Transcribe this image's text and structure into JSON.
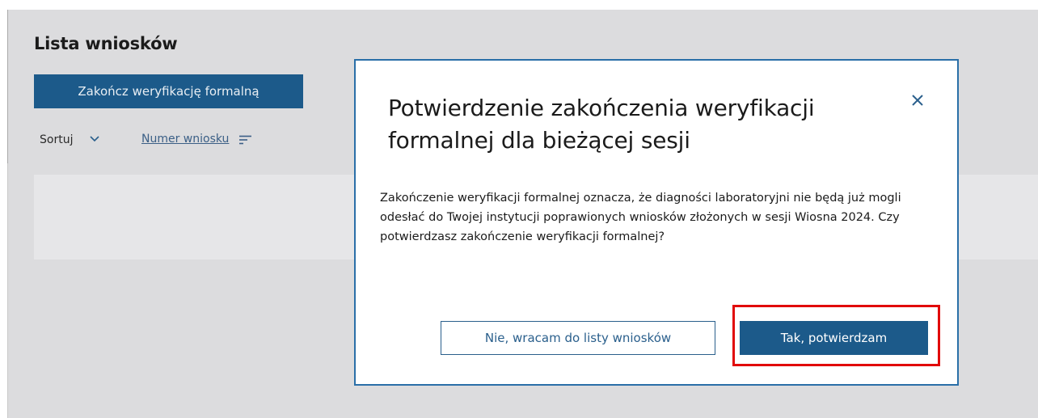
{
  "list": {
    "title": "Lista wniosków",
    "finish_button": "Zakończ weryfikację formalną",
    "sort_label": "Sortuj",
    "sort_field": "Numer wniosku"
  },
  "modal": {
    "title": "Potwierdzenie zakończenia weryfikacji formalnej dla bieżącej sesji",
    "body": "Zakończenie weryfikacji formalnej oznacza, że diagności laboratoryjni nie będą już mogli odesłać do Twojej instytucji poprawionych wniosków złożonych w sesji Wiosna 2024. Czy potwierdzasz zakończenie weryfikacji formalnej?",
    "cancel_button": "Nie, wracam do listy wniosków",
    "confirm_button": "Tak, potwierdzam"
  },
  "icons": {
    "close": "close-icon",
    "sort_dropdown": "chevron-down-icon",
    "sort_order": "sort-lines-icon"
  },
  "colors": {
    "primary": "#1c5a8a",
    "modal_border": "#2a6fa8",
    "highlight": "#e10a0a",
    "backdrop": "#dcdcde"
  }
}
